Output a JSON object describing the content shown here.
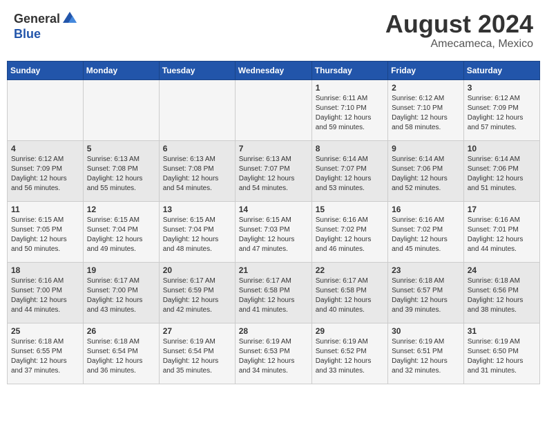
{
  "header": {
    "logo_general": "General",
    "logo_blue": "Blue",
    "title": "August 2024",
    "subtitle": "Amecameca, Mexico"
  },
  "days_of_week": [
    "Sunday",
    "Monday",
    "Tuesday",
    "Wednesday",
    "Thursday",
    "Friday",
    "Saturday"
  ],
  "weeks": [
    [
      {
        "day": "",
        "info": ""
      },
      {
        "day": "",
        "info": ""
      },
      {
        "day": "",
        "info": ""
      },
      {
        "day": "",
        "info": ""
      },
      {
        "day": "1",
        "info": "Sunrise: 6:11 AM\nSunset: 7:10 PM\nDaylight: 12 hours\nand 59 minutes."
      },
      {
        "day": "2",
        "info": "Sunrise: 6:12 AM\nSunset: 7:10 PM\nDaylight: 12 hours\nand 58 minutes."
      },
      {
        "day": "3",
        "info": "Sunrise: 6:12 AM\nSunset: 7:09 PM\nDaylight: 12 hours\nand 57 minutes."
      }
    ],
    [
      {
        "day": "4",
        "info": "Sunrise: 6:12 AM\nSunset: 7:09 PM\nDaylight: 12 hours\nand 56 minutes."
      },
      {
        "day": "5",
        "info": "Sunrise: 6:13 AM\nSunset: 7:08 PM\nDaylight: 12 hours\nand 55 minutes."
      },
      {
        "day": "6",
        "info": "Sunrise: 6:13 AM\nSunset: 7:08 PM\nDaylight: 12 hours\nand 54 minutes."
      },
      {
        "day": "7",
        "info": "Sunrise: 6:13 AM\nSunset: 7:07 PM\nDaylight: 12 hours\nand 54 minutes."
      },
      {
        "day": "8",
        "info": "Sunrise: 6:14 AM\nSunset: 7:07 PM\nDaylight: 12 hours\nand 53 minutes."
      },
      {
        "day": "9",
        "info": "Sunrise: 6:14 AM\nSunset: 7:06 PM\nDaylight: 12 hours\nand 52 minutes."
      },
      {
        "day": "10",
        "info": "Sunrise: 6:14 AM\nSunset: 7:06 PM\nDaylight: 12 hours\nand 51 minutes."
      }
    ],
    [
      {
        "day": "11",
        "info": "Sunrise: 6:15 AM\nSunset: 7:05 PM\nDaylight: 12 hours\nand 50 minutes."
      },
      {
        "day": "12",
        "info": "Sunrise: 6:15 AM\nSunset: 7:04 PM\nDaylight: 12 hours\nand 49 minutes."
      },
      {
        "day": "13",
        "info": "Sunrise: 6:15 AM\nSunset: 7:04 PM\nDaylight: 12 hours\nand 48 minutes."
      },
      {
        "day": "14",
        "info": "Sunrise: 6:15 AM\nSunset: 7:03 PM\nDaylight: 12 hours\nand 47 minutes."
      },
      {
        "day": "15",
        "info": "Sunrise: 6:16 AM\nSunset: 7:02 PM\nDaylight: 12 hours\nand 46 minutes."
      },
      {
        "day": "16",
        "info": "Sunrise: 6:16 AM\nSunset: 7:02 PM\nDaylight: 12 hours\nand 45 minutes."
      },
      {
        "day": "17",
        "info": "Sunrise: 6:16 AM\nSunset: 7:01 PM\nDaylight: 12 hours\nand 44 minutes."
      }
    ],
    [
      {
        "day": "18",
        "info": "Sunrise: 6:16 AM\nSunset: 7:00 PM\nDaylight: 12 hours\nand 44 minutes."
      },
      {
        "day": "19",
        "info": "Sunrise: 6:17 AM\nSunset: 7:00 PM\nDaylight: 12 hours\nand 43 minutes."
      },
      {
        "day": "20",
        "info": "Sunrise: 6:17 AM\nSunset: 6:59 PM\nDaylight: 12 hours\nand 42 minutes."
      },
      {
        "day": "21",
        "info": "Sunrise: 6:17 AM\nSunset: 6:58 PM\nDaylight: 12 hours\nand 41 minutes."
      },
      {
        "day": "22",
        "info": "Sunrise: 6:17 AM\nSunset: 6:58 PM\nDaylight: 12 hours\nand 40 minutes."
      },
      {
        "day": "23",
        "info": "Sunrise: 6:18 AM\nSunset: 6:57 PM\nDaylight: 12 hours\nand 39 minutes."
      },
      {
        "day": "24",
        "info": "Sunrise: 6:18 AM\nSunset: 6:56 PM\nDaylight: 12 hours\nand 38 minutes."
      }
    ],
    [
      {
        "day": "25",
        "info": "Sunrise: 6:18 AM\nSunset: 6:55 PM\nDaylight: 12 hours\nand 37 minutes."
      },
      {
        "day": "26",
        "info": "Sunrise: 6:18 AM\nSunset: 6:54 PM\nDaylight: 12 hours\nand 36 minutes."
      },
      {
        "day": "27",
        "info": "Sunrise: 6:19 AM\nSunset: 6:54 PM\nDaylight: 12 hours\nand 35 minutes."
      },
      {
        "day": "28",
        "info": "Sunrise: 6:19 AM\nSunset: 6:53 PM\nDaylight: 12 hours\nand 34 minutes."
      },
      {
        "day": "29",
        "info": "Sunrise: 6:19 AM\nSunset: 6:52 PM\nDaylight: 12 hours\nand 33 minutes."
      },
      {
        "day": "30",
        "info": "Sunrise: 6:19 AM\nSunset: 6:51 PM\nDaylight: 12 hours\nand 32 minutes."
      },
      {
        "day": "31",
        "info": "Sunrise: 6:19 AM\nSunset: 6:50 PM\nDaylight: 12 hours\nand 31 minutes."
      }
    ]
  ]
}
